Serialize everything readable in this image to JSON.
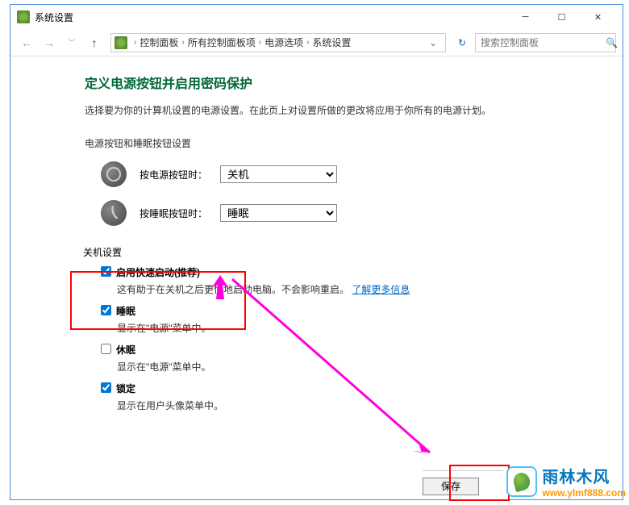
{
  "titlebar": {
    "title": "系统设置"
  },
  "breadcrumb": {
    "items": [
      "控制面板",
      "所有控制面板项",
      "电源选项",
      "系统设置"
    ]
  },
  "search": {
    "placeholder": "搜索控制面板"
  },
  "heading": "定义电源按钮并启用密码保护",
  "subtext": "选择要为你的计算机设置的电源设置。在此页上对设置所做的更改将应用于你所有的电源计划。",
  "button_section_label": "电源按钮和睡眠按钮设置",
  "power_button": {
    "label": "按电源按钮时：",
    "value": "关机"
  },
  "sleep_button": {
    "label": "按睡眠按钮时：",
    "value": "睡眠"
  },
  "shutdown_section_title": "关机设置",
  "fast_startup": {
    "label": "启用快速启动(推荐)",
    "checked": true,
    "desc_prefix": "这有助于在关机之后更快地启动电脑。不会影响重启。",
    "link": "了解更多信息"
  },
  "sleep_option": {
    "label": "睡眠",
    "checked": true,
    "desc": "显示在\"电源\"菜单中。"
  },
  "hibernate_option": {
    "label": "休眠",
    "checked": false,
    "desc": "显示在\"电源\"菜单中。"
  },
  "lock_option": {
    "label": "锁定",
    "checked": true,
    "desc": "显示在用户头像菜单中。"
  },
  "save_button": "保存",
  "watermark": {
    "cn": "雨林木风",
    "url": "www.ylmf888.com"
  }
}
